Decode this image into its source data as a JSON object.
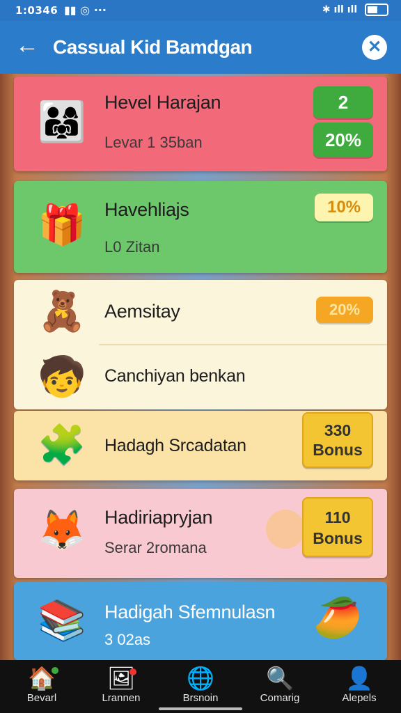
{
  "status": {
    "time": "1:0346",
    "indicators": "▮▮ ◎ ···",
    "right_icons": "✱ ıll ıll"
  },
  "appbar": {
    "title": "Cassual  Kid Bamdgan",
    "back_icon": "arrow-left-icon",
    "close_icon": "close-circle-icon"
  },
  "colors": {
    "appbar": "#2b7dcb",
    "red_card": "#f2697a",
    "green_card": "#6cc86a",
    "cream_card": "#fbf5dc",
    "yellow_card": "#fbe3a8",
    "pink_card": "#f9c9d2",
    "blue_card": "#4aa3dc",
    "badge_green": "#3faa3e",
    "badge_yellow": "#f4c533",
    "badge_orange": "#f5a623"
  },
  "items": [
    {
      "title": "Hevel Harajan",
      "subtitle": "Levar 1 35ban",
      "badge_top": "2",
      "badge_bottom": "20%",
      "icon": "kids-family-icon"
    },
    {
      "title": "Havehliajs",
      "subtitle": "L0 Zitan",
      "badge": "10%",
      "icon": "gift-box-icon"
    },
    {
      "title": "Aemsitay",
      "badge": "20%",
      "icon": "toys-icon"
    },
    {
      "title": "Canchiyan benkan",
      "icon": "doll-icon"
    },
    {
      "title": "Hadagh Srcadatan",
      "badge_line1": "330",
      "badge_line2": "Bonus",
      "icon": "pillow-toy-icon"
    },
    {
      "title": "Hadiriapryjan",
      "subtitle": "Serar 2romana",
      "badge_line1": "110",
      "badge_line2": "Bonus",
      "icon": "gift-animal-icon"
    },
    {
      "title": "Hadigah Sfemnulasn",
      "subtitle": "3 02as",
      "icon": "books-icon",
      "icon_right": "snack-icon"
    }
  ],
  "nav": [
    {
      "label": "Bevarl",
      "icon": "home-icon"
    },
    {
      "label": "Lrannen",
      "icon": "image-icon"
    },
    {
      "label": "Brsnoin",
      "icon": "globe-icon"
    },
    {
      "label": "Comarig",
      "icon": "search-icon"
    },
    {
      "label": "Alepels",
      "icon": "profile-icon"
    }
  ]
}
